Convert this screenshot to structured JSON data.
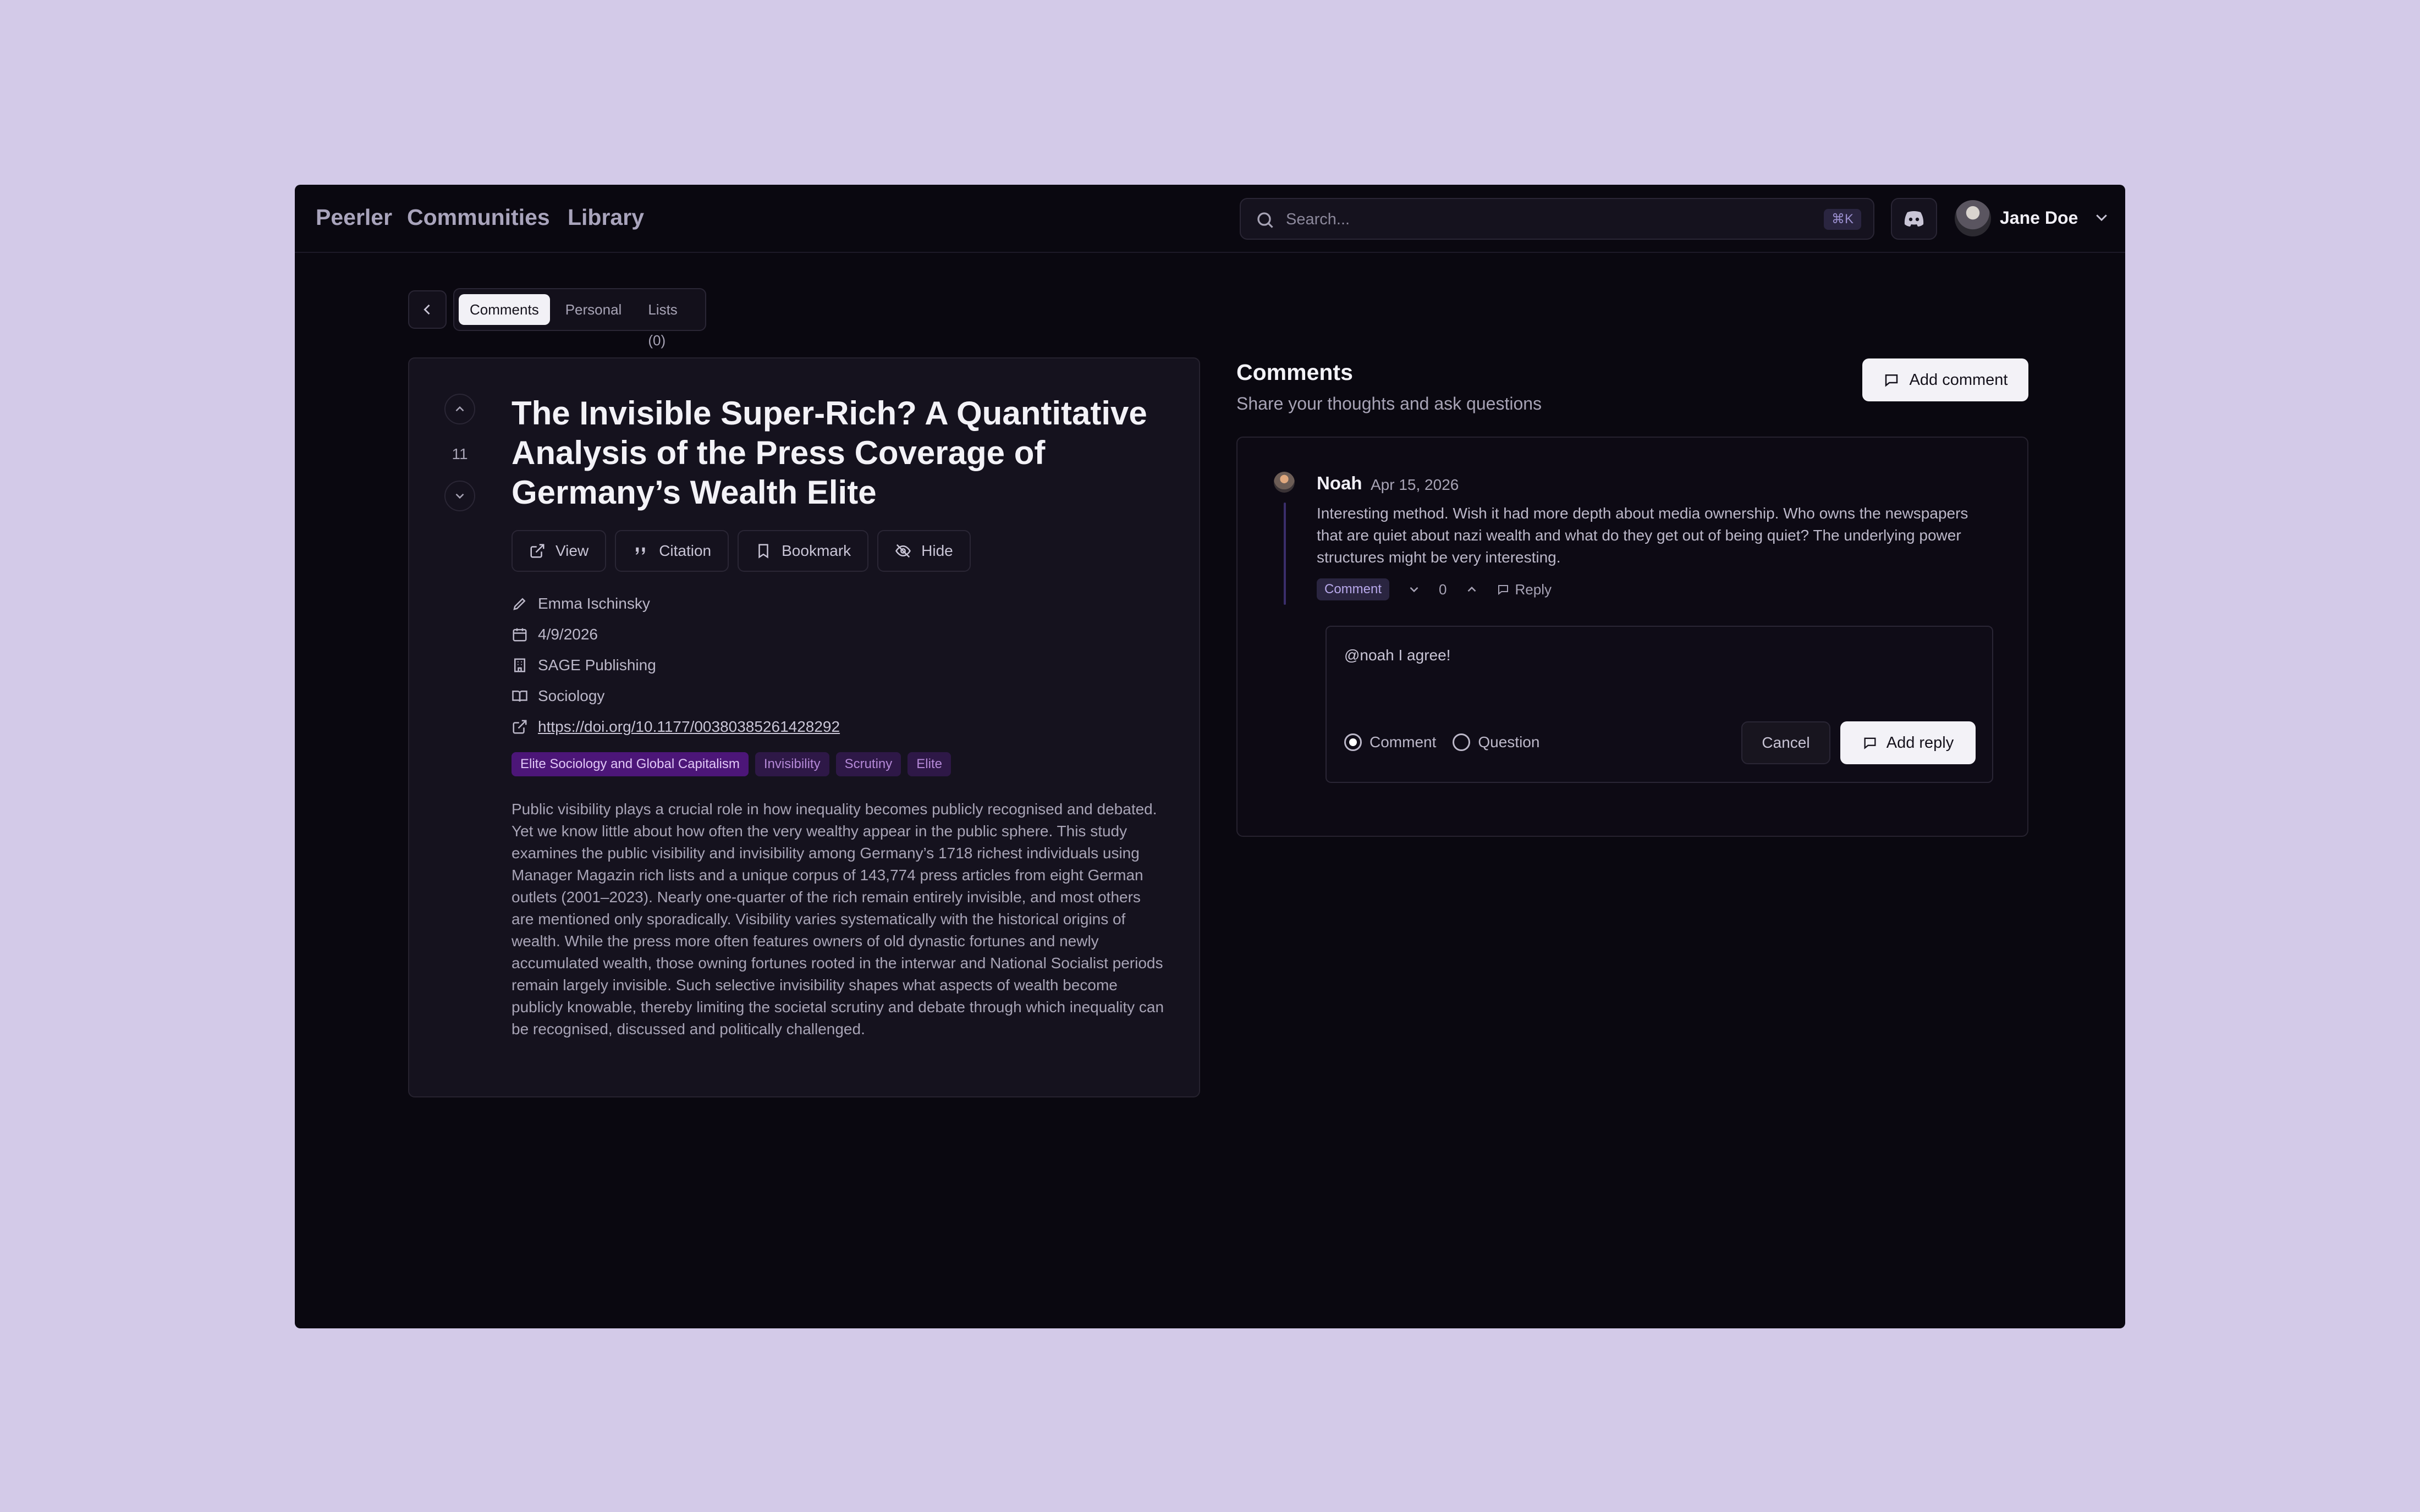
{
  "nav": {
    "brand": "Peerler",
    "communities": "Communities",
    "library": "Library"
  },
  "search": {
    "placeholder": "Search...",
    "shortcut": "⌘K"
  },
  "user": {
    "name": "Jane Doe"
  },
  "tabs": [
    {
      "label": "Comments",
      "active": true
    },
    {
      "label": "Personal",
      "active": false
    },
    {
      "label": "Lists (0)",
      "active": false
    }
  ],
  "paper": {
    "votes": "11",
    "title": "The Invisible Super-Rich? A Quantitative Analysis of the Press Coverage of Germany’s Wealth Elite",
    "actions": {
      "view": "View",
      "citation": "Citation",
      "bookmark": "Bookmark",
      "hide": "Hide"
    },
    "author": "Emma Ischinsky",
    "date": "4/9/2026",
    "publisher": "SAGE Publishing",
    "field": "Sociology",
    "doi": "https://doi.org/10.1177/00380385261428292",
    "tags": [
      "Elite Sociology and Global Capitalism",
      "Invisibility",
      "Scrutiny",
      "Elite"
    ],
    "abstract": "Public visibility plays a crucial role in how inequality becomes publicly recognised and debated. Yet we know little about how often the very wealthy appear in the public sphere. This study examines the public visibility and invisibility among Germany’s 1718 richest individuals using Manager Magazin rich lists and a unique corpus of 143,774 press articles from eight German outlets (2001–2023). Nearly one-quarter of the rich remain entirely invisible, and most others are mentioned only sporadically. Visibility varies systematically with the historical origins of wealth. While the press more often features owners of old dynastic fortunes and newly accumulated wealth, those owning fortunes rooted in the interwar and National Socialist periods remain largely invisible. Such selective invisibility shapes what aspects of wealth become publicly knowable, thereby limiting the societal scrutiny and debate through which inequality can be recognised, discussed and politically challenged."
  },
  "comments": {
    "heading": "Comments",
    "subheading": "Share your thoughts and ask questions",
    "add_label": "Add comment",
    "items": [
      {
        "author": "Noah",
        "date": "Apr 15, 2026",
        "body": "Interesting method. Wish it had more depth about media ownership. Who owns the newspapers that are quiet about nazi wealth and what do they get out of being quiet? The underlying power structures might be very interesting.",
        "badge": "Comment",
        "score": "0",
        "reply_label": "Reply"
      }
    ],
    "reply": {
      "text": "@noah I agree!",
      "type_comment": "Comment",
      "type_question": "Question",
      "selected": "Comment",
      "cancel": "Cancel",
      "submit": "Add reply"
    }
  },
  "colors": {
    "background": "#d3cae8",
    "window": "#0a0810",
    "accent": "#4c1678"
  }
}
